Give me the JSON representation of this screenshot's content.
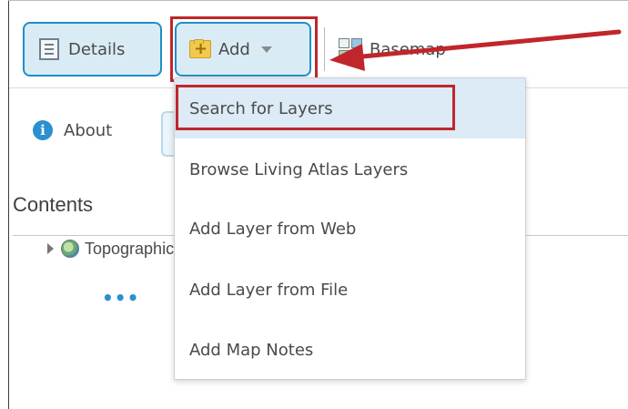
{
  "toolbar": {
    "details_label": "Details",
    "add_label": "Add",
    "basemap_label": "Basemap"
  },
  "panel": {
    "about_label": "About",
    "contents_title": "Contents",
    "layer_label": "Topographic",
    "more_label": "•••"
  },
  "add_menu": {
    "items": [
      {
        "label": "Search for Layers",
        "state": "hover"
      },
      {
        "label": "Browse Living Atlas Layers"
      },
      {
        "label": "Add Layer from Web"
      },
      {
        "label": "Add Layer from File"
      },
      {
        "label": "Add Map Notes"
      }
    ]
  },
  "icons": {
    "details": "details-list-icon",
    "add": "add-folder-icon",
    "basemap": "basemap-grid-icon",
    "about": "info-icon",
    "layer": "globe-icon"
  },
  "colors": {
    "accent": "#1f8ec6",
    "annotation_red": "#c0262b",
    "menu_hover": "#dcebf6"
  }
}
